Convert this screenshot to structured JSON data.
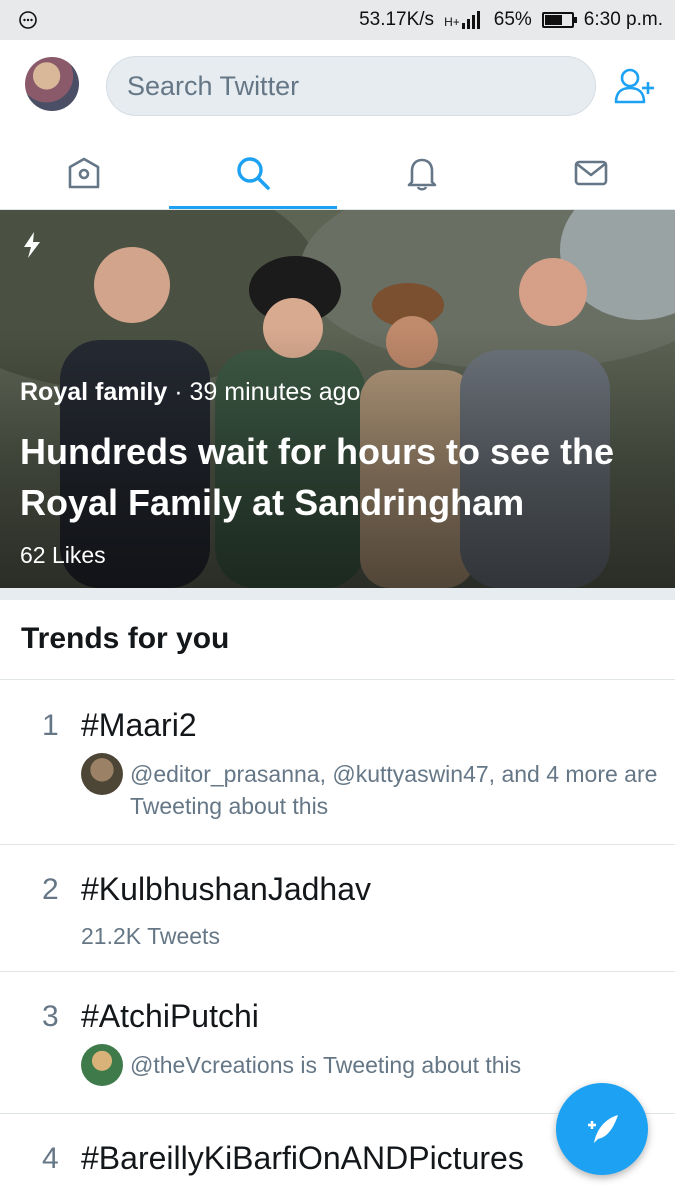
{
  "status_bar": {
    "network_speed": "53.17K/s",
    "signal": "H+",
    "battery_percent": "65%",
    "battery_level": 0.65,
    "time": "6:30 p.m."
  },
  "header": {
    "search_placeholder": "Search Twitter",
    "avatar_icon": "profile-avatar",
    "add_user_icon": "add-user-icon"
  },
  "tabs": [
    {
      "name": "home",
      "icon": "home-icon",
      "active": false
    },
    {
      "name": "search",
      "icon": "search-icon",
      "active": true
    },
    {
      "name": "notifications",
      "icon": "bell-icon",
      "active": false
    },
    {
      "name": "messages",
      "icon": "mail-icon",
      "active": false
    }
  ],
  "hero": {
    "category": "Royal family",
    "time_separator": " · ",
    "time_ago": "39 minutes ago",
    "title": "Hundreds wait for hours to see the Royal Family at Sandringham",
    "likes": "62 Likes",
    "moment_icon": "lightning-icon"
  },
  "trends": {
    "heading": "Trends for you",
    "items": [
      {
        "rank": "1",
        "name": "#Maari2",
        "context": "@editor_prasanna, @kuttyaswin47, and 4 more are Tweeting about this"
      },
      {
        "rank": "2",
        "name": "#KulbhushanJadhav",
        "tweets": "21.2K Tweets"
      },
      {
        "rank": "3",
        "name": "#AtchiPutchi",
        "context": "@theVcreations is Tweeting about this"
      },
      {
        "rank": "4",
        "name": "#BareillyKiBarfiOnANDPictures"
      }
    ]
  },
  "compose_button": {
    "icon": "compose-tweet-icon"
  },
  "colors": {
    "accent": "#1da1f2",
    "secondary_text": "#657786",
    "primary_text": "#14171a"
  }
}
